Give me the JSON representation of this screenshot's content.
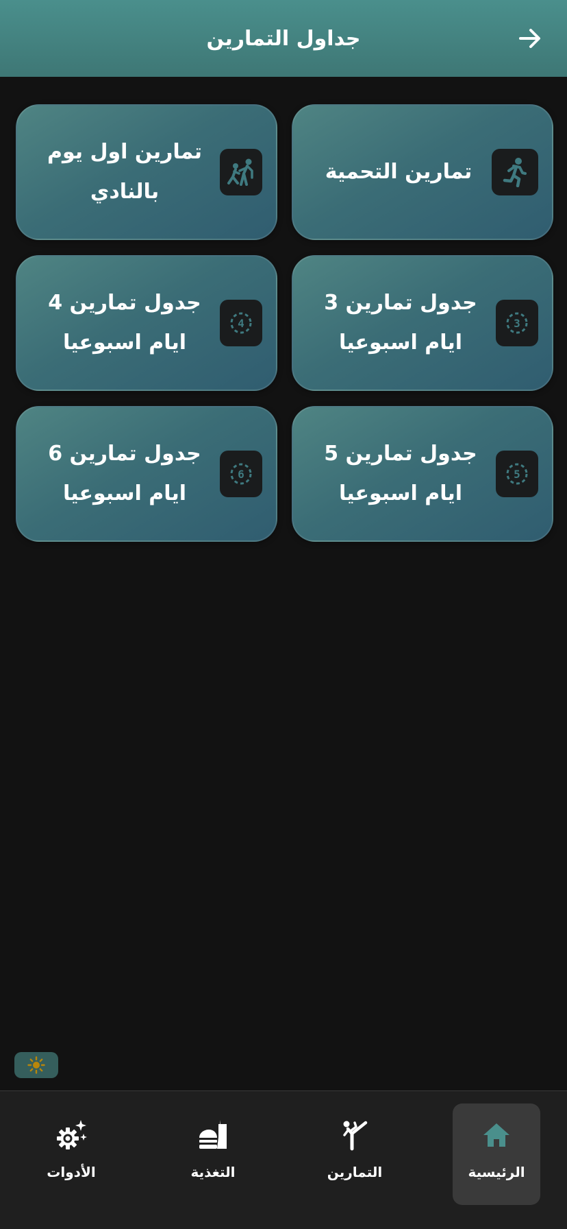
{
  "header": {
    "title": "جداول التمارين",
    "back_icon": "arrow-right-icon"
  },
  "cards": [
    {
      "label": "تمارين التحمية",
      "icon": "running-icon"
    },
    {
      "label": "تمارين اول يوم بالنادي",
      "icon": "trainer-icon"
    },
    {
      "label": "جدول تمارين 3 ايام اسبوعيا",
      "icon": "number-3-circle-icon",
      "number": "3"
    },
    {
      "label": "جدول تمارين 4 ايام اسبوعيا",
      "icon": "number-4-circle-icon",
      "number": "4"
    },
    {
      "label": "جدول تمارين 5 ايام اسبوعيا",
      "icon": "number-5-circle-icon",
      "number": "5"
    },
    {
      "label": "جدول تمارين 6 ايام اسبوعيا",
      "icon": "number-6-circle-icon",
      "number": "6"
    }
  ],
  "theme_toggle": {
    "icon": "sun-icon"
  },
  "bottom_nav": [
    {
      "label": "الرئيسية",
      "icon": "home-icon",
      "active": true
    },
    {
      "label": "التمارين",
      "icon": "karate-icon",
      "active": false
    },
    {
      "label": "التغذية",
      "icon": "fastfood-icon",
      "active": false
    },
    {
      "label": "الأدوات",
      "icon": "settings-sparkle-icon",
      "active": false
    }
  ],
  "colors": {
    "header": "#4a8f8c",
    "background": "#121212",
    "card_icon_bg": "#1a1c1d",
    "accent": "#4a8f8c",
    "nav_bg": "#1f1f1f",
    "nav_active_bg": "#3a3a3a",
    "sun": "#b8860b"
  }
}
